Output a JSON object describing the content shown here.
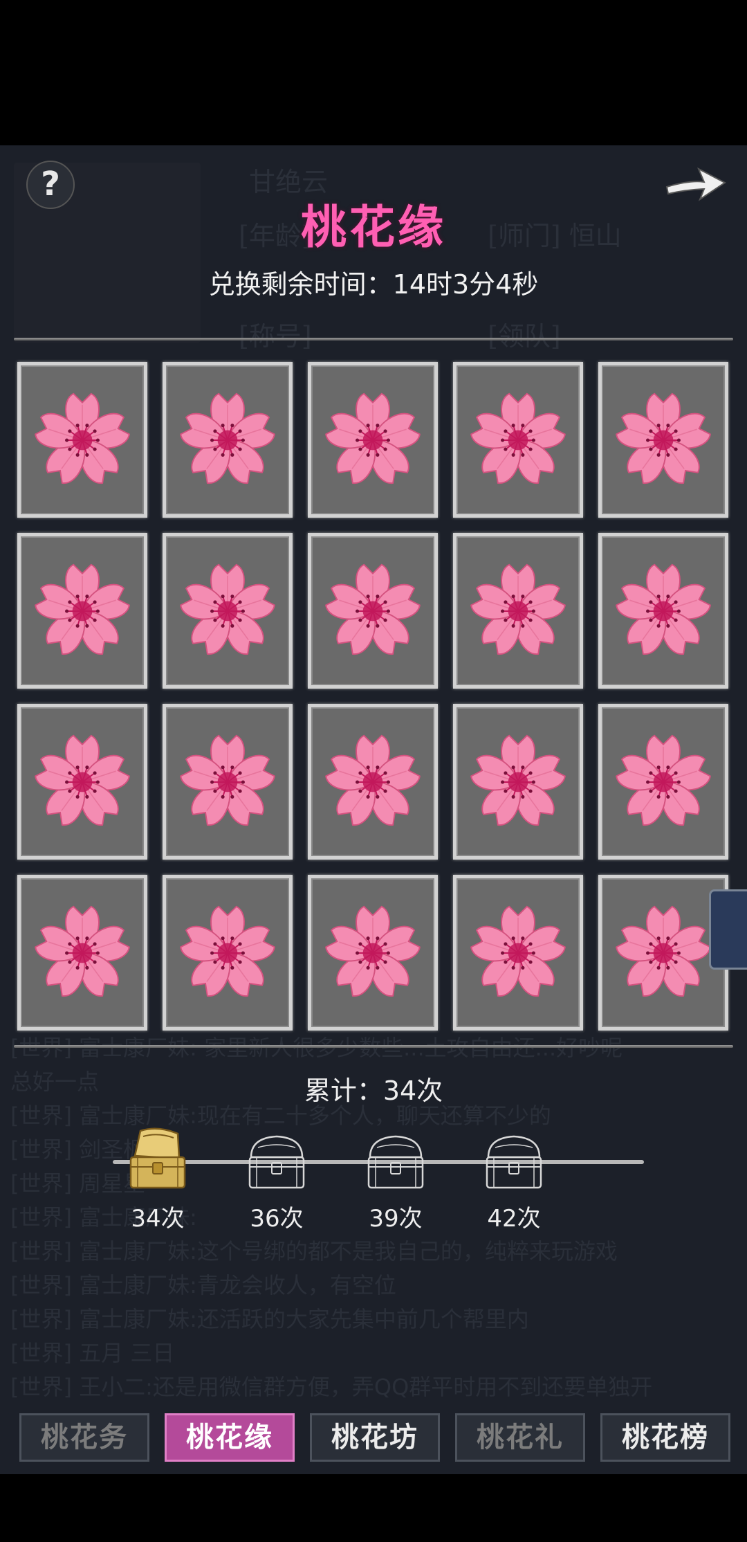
{
  "background": {
    "name": "甘绝云",
    "info_lines": [
      "[年龄]",
      "[师门] 恒山",
      "[称号]",
      "[领队]"
    ],
    "chat": [
      "[世界] 富士康厂妹: 家里新人很多少数些...土攻自由还...好吵呢",
      "总好一点",
      "[世界] 富士康厂妹:现在有二十多个人，聊天还算不少的",
      "[世界] 剑圣枫",
      "[世界] 周星星",
      "[世界] 富士康厂妹:",
      "[世界] 富士康厂妹:这个号绑的都不是我自己的，纯粹来玩游戏",
      "[世界] 富士康厂妹:青龙会收人，有空位",
      "[世界] 富士康厂妹:还活跃的大家先集中前几个帮里内",
      "[世界] 五月 三日",
      "[世界] 王小二:还是用微信群方便，弄QQ群平时用不到还要单独开"
    ]
  },
  "header": {
    "help_label": "?",
    "title": "桃花缘",
    "timer": "兑换剩余时间：14时3分4秒"
  },
  "grid": {
    "rows": 4,
    "cols": 5,
    "item_icon": "peach-blossom-icon",
    "petal_color": "#f48cb2",
    "center_color": "#c2185b"
  },
  "progress": {
    "total_label": "累计：34次",
    "current": 34,
    "milestones": [
      {
        "label": "34次",
        "count": 34,
        "state": "opened"
      },
      {
        "label": "36次",
        "count": 36,
        "state": "locked"
      },
      {
        "label": "39次",
        "count": 39,
        "state": "locked"
      },
      {
        "label": "42次",
        "count": 42,
        "state": "locked"
      }
    ]
  },
  "tabs": [
    {
      "label": "桃花务",
      "state": "dim"
    },
    {
      "label": "桃花缘",
      "state": "active"
    },
    {
      "label": "桃花坊",
      "state": "normal"
    },
    {
      "label": "桃花礼",
      "state": "dim"
    },
    {
      "label": "桃花榜",
      "state": "normal"
    }
  ],
  "colors": {
    "accent": "#ff5fb3",
    "tab_active": "#b44a9a",
    "panel": "#1c2029",
    "chest_gold": "#d4b45a"
  }
}
